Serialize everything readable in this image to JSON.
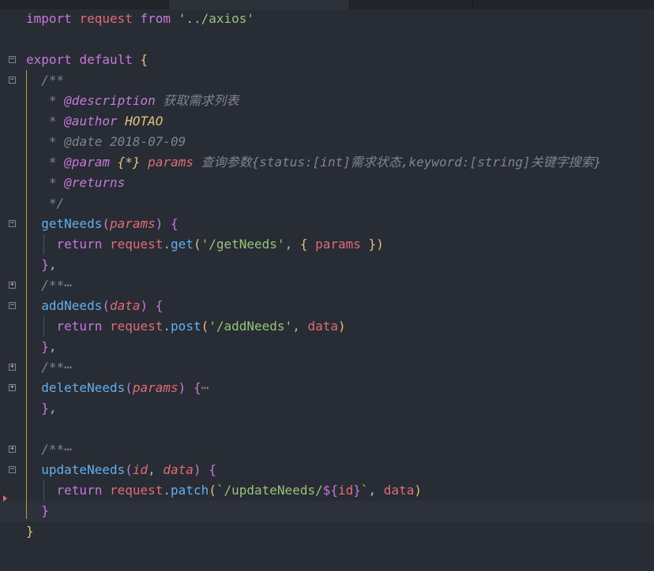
{
  "editor": {
    "lines": [
      {
        "segments": [
          {
            "t": "import",
            "c": "k"
          },
          {
            "t": " ",
            "c": ""
          },
          {
            "t": "request",
            "c": "v"
          },
          {
            "t": " ",
            "c": ""
          },
          {
            "t": "from",
            "c": "k"
          },
          {
            "t": " ",
            "c": ""
          },
          {
            "t": "'../axios'",
            "c": "s"
          }
        ]
      },
      {
        "segments": []
      },
      {
        "fold": "−",
        "segments": [
          {
            "t": "export",
            "c": "k"
          },
          {
            "t": " ",
            "c": ""
          },
          {
            "t": "default",
            "c": "k"
          },
          {
            "t": " ",
            "c": ""
          },
          {
            "t": "{",
            "c": "y"
          }
        ]
      },
      {
        "fold": "−",
        "segments": [
          {
            "t": "  /**",
            "c": "c"
          }
        ]
      },
      {
        "segments": [
          {
            "t": "   * ",
            "c": "c"
          },
          {
            "t": "@description",
            "c": "ct"
          },
          {
            "t": " ",
            "c": "c"
          },
          {
            "t": "获取需求列表",
            "c": "c cjk"
          }
        ]
      },
      {
        "segments": [
          {
            "t": "   * ",
            "c": "c"
          },
          {
            "t": "@author",
            "c": "ct"
          },
          {
            "t": " ",
            "c": "c"
          },
          {
            "t": "HOTAO",
            "c": "cy"
          }
        ]
      },
      {
        "segments": [
          {
            "t": "   * ",
            "c": "c"
          },
          {
            "t": "@date 2018-07-09",
            "c": "c"
          }
        ]
      },
      {
        "segments": [
          {
            "t": "   * ",
            "c": "c"
          },
          {
            "t": "@param",
            "c": "ct"
          },
          {
            "t": " ",
            "c": "c"
          },
          {
            "t": "{*}",
            "c": "cy"
          },
          {
            "t": " ",
            "c": "c"
          },
          {
            "t": "params",
            "c": "cr"
          },
          {
            "t": " ",
            "c": "c"
          },
          {
            "t": "查询参数",
            "c": "c cjk"
          },
          {
            "t": "{status:[int]",
            "c": "c"
          },
          {
            "t": "需求状态",
            "c": "c cjk"
          },
          {
            "t": ",keyword:[string]",
            "c": "c"
          },
          {
            "t": "关键字搜索",
            "c": "c cjk"
          },
          {
            "t": "}",
            "c": "c"
          }
        ]
      },
      {
        "segments": [
          {
            "t": "   * ",
            "c": "c"
          },
          {
            "t": "@returns",
            "c": "ct"
          }
        ]
      },
      {
        "segments": [
          {
            "t": "   */",
            "c": "c"
          }
        ]
      },
      {
        "fold": "−",
        "segments": [
          {
            "t": "  ",
            "c": ""
          },
          {
            "t": "getNeeds",
            "c": "f"
          },
          {
            "t": "(",
            "c": "mag"
          },
          {
            "t": "params",
            "c": "p"
          },
          {
            "t": ")",
            "c": "mag"
          },
          {
            "t": " ",
            "c": ""
          },
          {
            "t": "{",
            "c": "mag"
          }
        ]
      },
      {
        "segments": [
          {
            "t": "    ",
            "c": ""
          },
          {
            "t": "return",
            "c": "k"
          },
          {
            "t": " ",
            "c": ""
          },
          {
            "t": "request",
            "c": "v"
          },
          {
            "t": ".",
            "c": ""
          },
          {
            "t": "get",
            "c": "f"
          },
          {
            "t": "(",
            "c": "y"
          },
          {
            "t": "'/getNeeds'",
            "c": "s"
          },
          {
            "t": ", ",
            "c": ""
          },
          {
            "t": "{",
            "c": "y"
          },
          {
            "t": " ",
            "c": ""
          },
          {
            "t": "params",
            "c": "v"
          },
          {
            "t": " ",
            "c": ""
          },
          {
            "t": "}",
            "c": "y"
          },
          {
            "t": ")",
            "c": "y"
          }
        ]
      },
      {
        "segments": [
          {
            "t": "  ",
            "c": ""
          },
          {
            "t": "}",
            "c": "mag"
          },
          {
            "t": ",",
            "c": ""
          }
        ]
      },
      {
        "fold": "+",
        "segments": [
          {
            "t": "  /**",
            "c": "c"
          },
          {
            "t": "⋯",
            "c": "ell"
          }
        ]
      },
      {
        "fold": "−",
        "segments": [
          {
            "t": "  ",
            "c": ""
          },
          {
            "t": "addNeeds",
            "c": "f"
          },
          {
            "t": "(",
            "c": "mag"
          },
          {
            "t": "data",
            "c": "p"
          },
          {
            "t": ")",
            "c": "mag"
          },
          {
            "t": " ",
            "c": ""
          },
          {
            "t": "{",
            "c": "mag"
          }
        ]
      },
      {
        "segments": [
          {
            "t": "    ",
            "c": ""
          },
          {
            "t": "return",
            "c": "k"
          },
          {
            "t": " ",
            "c": ""
          },
          {
            "t": "request",
            "c": "v"
          },
          {
            "t": ".",
            "c": ""
          },
          {
            "t": "post",
            "c": "f"
          },
          {
            "t": "(",
            "c": "y"
          },
          {
            "t": "'/addNeeds'",
            "c": "s"
          },
          {
            "t": ", ",
            "c": ""
          },
          {
            "t": "data",
            "c": "v"
          },
          {
            "t": ")",
            "c": "y"
          }
        ]
      },
      {
        "segments": [
          {
            "t": "  ",
            "c": ""
          },
          {
            "t": "}",
            "c": "mag"
          },
          {
            "t": ",",
            "c": ""
          }
        ]
      },
      {
        "fold": "+",
        "segments": [
          {
            "t": "  /**",
            "c": "c"
          },
          {
            "t": "⋯",
            "c": "ell"
          }
        ]
      },
      {
        "fold": "+",
        "segments": [
          {
            "t": "  ",
            "c": ""
          },
          {
            "t": "deleteNeeds",
            "c": "f"
          },
          {
            "t": "(",
            "c": "mag"
          },
          {
            "t": "params",
            "c": "p"
          },
          {
            "t": ")",
            "c": "mag"
          },
          {
            "t": " ",
            "c": ""
          },
          {
            "t": "{",
            "c": "mag"
          },
          {
            "t": "⋯",
            "c": "ell"
          }
        ]
      },
      {
        "segments": [
          {
            "t": "  ",
            "c": ""
          },
          {
            "t": "}",
            "c": "mag"
          },
          {
            "t": ",",
            "c": ""
          }
        ]
      },
      {
        "segments": []
      },
      {
        "fold": "+",
        "segments": [
          {
            "t": "  /**",
            "c": "c"
          },
          {
            "t": "⋯",
            "c": "ell"
          }
        ]
      },
      {
        "fold": "−",
        "segments": [
          {
            "t": "  ",
            "c": ""
          },
          {
            "t": "updateNeeds",
            "c": "f"
          },
          {
            "t": "(",
            "c": "mag"
          },
          {
            "t": "id",
            "c": "p"
          },
          {
            "t": ", ",
            "c": ""
          },
          {
            "t": "data",
            "c": "p"
          },
          {
            "t": ")",
            "c": "mag"
          },
          {
            "t": " ",
            "c": ""
          },
          {
            "t": "{",
            "c": "mag"
          }
        ]
      },
      {
        "segments": [
          {
            "t": "    ",
            "c": ""
          },
          {
            "t": "return",
            "c": "k"
          },
          {
            "t": " ",
            "c": ""
          },
          {
            "t": "request",
            "c": "v"
          },
          {
            "t": ".",
            "c": ""
          },
          {
            "t": "patch",
            "c": "f"
          },
          {
            "t": "(",
            "c": "y"
          },
          {
            "t": "`/updateNeeds/",
            "c": "s"
          },
          {
            "t": "${",
            "c": "mag"
          },
          {
            "t": "id",
            "c": "v"
          },
          {
            "t": "}",
            "c": "mag"
          },
          {
            "t": "`",
            "c": "s"
          },
          {
            "t": ", ",
            "c": ""
          },
          {
            "t": "data",
            "c": "v"
          },
          {
            "t": ")",
            "c": "y"
          }
        ]
      },
      {
        "cursor": true,
        "segments": [
          {
            "t": "  ",
            "c": ""
          },
          {
            "t": "}",
            "c": "mag"
          }
        ]
      },
      {
        "segments": [
          {
            "t": "}",
            "c": "y"
          }
        ]
      }
    ]
  }
}
